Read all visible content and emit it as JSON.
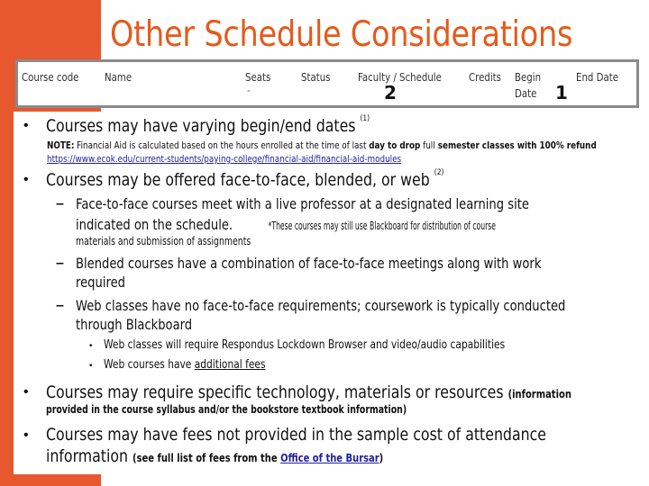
{
  "title": "Other Schedule Considerations",
  "colors": {
    "accent": "#E8582E",
    "title": "#E55A1B",
    "link": "#1f1fa0",
    "box_border": "#8a8a8a"
  },
  "schedule_header": {
    "columns": [
      "Course code",
      "Name",
      "Seats",
      "Status",
      "Faculty / Schedule",
      "Credits",
      "Begin",
      "Date",
      "End Date"
    ],
    "seats_placeholder": "-",
    "markers": {
      "faculty_schedule": "2",
      "dates": "1"
    }
  },
  "bullets": [
    {
      "text": "Courses may have varying begin/end dates",
      "sup": "(1)",
      "note_label": "NOTE:",
      "note_text_1": " Financial Aid is calculated based on the hours enrolled at the time of last ",
      "note_bold_1": "day to drop",
      "note_text_2": " full",
      "note_bold_2": " semester classes with 100% refund",
      "note_link": "https://www.ecok.edu/current-students/paying-college/financial-aid/financial-aid-modules"
    },
    {
      "text": "Courses may be offered face-to-face, blended, or web",
      "sup": "(2)",
      "sub": [
        {
          "line1": "Face-to-face courses meet with a live professor at a designated learning site",
          "line2": "indicated on the schedule.",
          "line2_small": "*These courses may still use Blackboard for distribution of course",
          "line3_small": "materials and submission of assignments"
        },
        {
          "line1": "Blended courses have a combination of face-to-face meetings along with work",
          "line2": "required"
        },
        {
          "line1": "Web classes have no face-to-face requirements; coursework is typically conducted",
          "line2": "through Blackboard",
          "sub": [
            {
              "text": "Web classes will require Respondus Lockdown Browser and video/audio capabilities"
            },
            {
              "text": "Web courses have ",
              "underlined": "additional fees"
            }
          ]
        }
      ]
    },
    {
      "text": "Courses may require specific technology, materials or resources",
      "small_1": "(information",
      "small_2": "provided in the course syllabus and/or the bookstore textbook information)"
    },
    {
      "line1": "Courses may have fees not provided in the sample cost of attendance",
      "line2": "information",
      "small_pre": "(see full list of fees from  the ",
      "link": "Office of the Bursar",
      "small_post": ")"
    }
  ],
  "bullet_glyph": "•",
  "dash_glyph": "–"
}
